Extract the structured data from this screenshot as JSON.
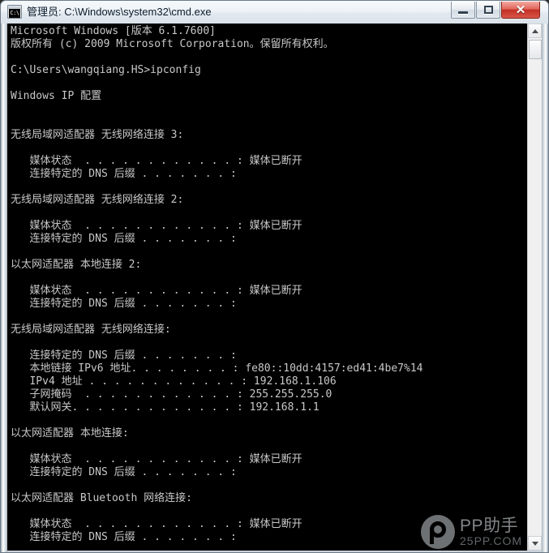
{
  "window": {
    "title": "管理员: C:\\Windows\\system32\\cmd.exe",
    "icon_label": "C:\\",
    "icon_name": "cmd-console-icon",
    "controls": {
      "minimize_label": "—",
      "maximize_label": "",
      "close_label": "✕"
    }
  },
  "console": {
    "lines": [
      "Microsoft Windows [版本 6.1.7600]",
      "版权所有 (c) 2009 Microsoft Corporation。保留所有权利。",
      "",
      "C:\\Users\\wangqiang.HS>ipconfig",
      "",
      "Windows IP 配置",
      "",
      "",
      "无线局域网适配器 无线网络连接 3:",
      "",
      "   媒体状态  . . . . . . . . . . . . : 媒体已断开",
      "   连接特定的 DNS 后缀 . . . . . . . :",
      "",
      "无线局域网适配器 无线网络连接 2:",
      "",
      "   媒体状态  . . . . . . . . . . . . : 媒体已断开",
      "   连接特定的 DNS 后缀 . . . . . . . :",
      "",
      "以太网适配器 本地连接 2:",
      "",
      "   媒体状态  . . . . . . . . . . . . : 媒体已断开",
      "   连接特定的 DNS 后缀 . . . . . . . :",
      "",
      "无线局域网适配器 无线网络连接:",
      "",
      "   连接特定的 DNS 后缀 . . . . . . . :",
      "   本地链接 IPv6 地址. . . . . . . . : fe80::10dd:4157:ed41:4be7%14",
      "   IPv4 地址 . . . . . . . . . . . . : 192.168.1.106",
      "   子网掩码  . . . . . . . . . . . . : 255.255.255.0",
      "   默认网关. . . . . . . . . . . . . : 192.168.1.1",
      "",
      "以太网适配器 本地连接:",
      "",
      "   媒体状态  . . . . . . . . . . . . : 媒体已断开",
      "   连接特定的 DNS 后缀 . . . . . . . :",
      "",
      "以太网适配器 Bluetooth 网络连接:",
      "",
      "   媒体状态  . . . . . . . . . . . . : 媒体已断开",
      "   连接特定的 DNS 后缀 . . . . . . . :"
    ],
    "background_color": "#000000",
    "text_color": "#c8c8c8"
  },
  "scrollbar": {
    "up_arrow": "▲",
    "down_arrow": "▼"
  },
  "watermark": {
    "main": "PP助手",
    "sub": "25PP.COM"
  }
}
